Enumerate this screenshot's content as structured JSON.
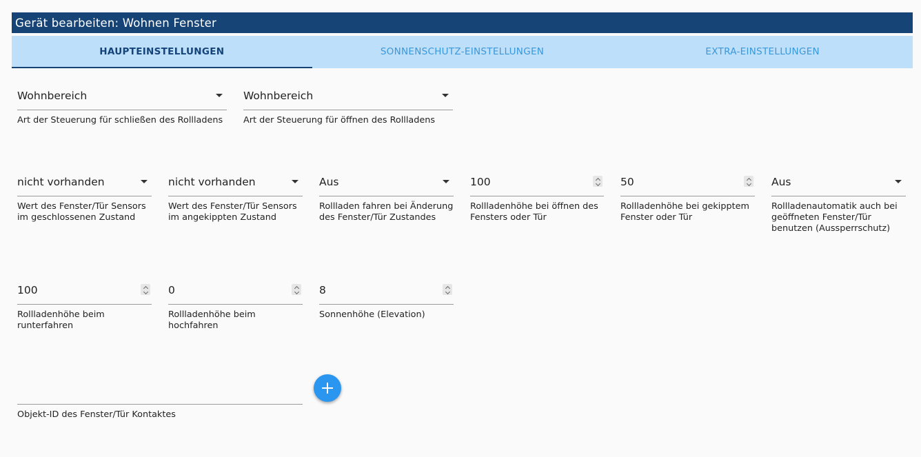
{
  "window": {
    "title": "Gerät bearbeiten: Wohnen Fenster"
  },
  "tabs": [
    {
      "label": "HAUPTEINSTELLUNGEN"
    },
    {
      "label": "SONNENSCHUTZ-EINSTELLUNGEN"
    },
    {
      "label": "EXTRA-EINSTELLUNGEN"
    }
  ],
  "fields": {
    "close_control": {
      "value": "Wohnbereich",
      "label": "Art der Steuerung für schließen des Rollladens"
    },
    "open_control": {
      "value": "Wohnbereich",
      "label": "Art der Steuerung für öffnen des Rollladens"
    },
    "sensor_closed": {
      "value": "nicht vorhanden",
      "label": "Wert des Fenster/Tür Sensors im geschlossenen Zustand"
    },
    "sensor_tilted": {
      "value": "nicht vorhanden",
      "label": "Wert des Fenster/Tür Sensors im angekippten Zustand"
    },
    "move_on_change": {
      "value": "Aus",
      "label": "Rollladen fahren bei Änderung des Fenster/Tür Zustandes"
    },
    "height_open_window": {
      "value": "100",
      "label": "Rollladenhöhe bei öffnen des Fensters oder Tür"
    },
    "height_tilted_window": {
      "value": "50",
      "label": "Rollladenhöhe bei gekipptem Fenster oder Tür"
    },
    "lockout_protection": {
      "value": "Aus",
      "label": "Rollladenautomatik auch bei geöffneten Fenster/Tür benutzen (Aussperrschutz)"
    },
    "height_down": {
      "value": "100",
      "label": "Rollladenhöhe beim runterfahren"
    },
    "height_up": {
      "value": "0",
      "label": "Rollladenhöhe beim hochfahren"
    },
    "sun_elevation": {
      "value": "8",
      "label": "Sonnenhöhe (Elevation)"
    },
    "contact_object_id": {
      "value": "",
      "label": "Objekt-ID des Fenster/Tür Kontaktes"
    }
  },
  "icons": {
    "add": "plus-icon",
    "select": "dropdown-arrow-icon",
    "number": "spinner-icon"
  },
  "colors": {
    "titlebar": "#174477",
    "tabbar": "#bedffa",
    "tab_inactive": "#3a97d8",
    "fab": "#2a96f0"
  }
}
